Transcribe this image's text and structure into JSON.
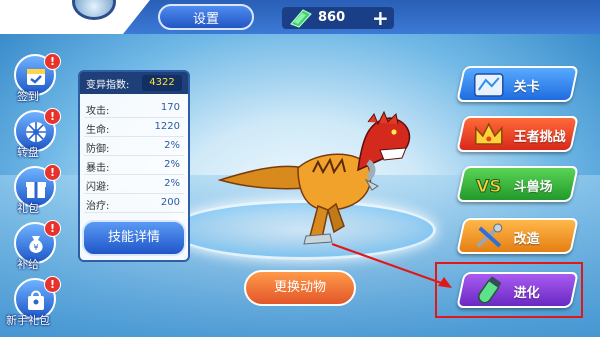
{
  "top": {
    "settings_label": "设置",
    "gem_count": "860",
    "plus_symbol": "+"
  },
  "side_buttons": [
    {
      "label": "签到",
      "badge": "!"
    },
    {
      "label": "转盘",
      "badge": "!"
    },
    {
      "label": "礼包",
      "badge": "!"
    },
    {
      "label": "补给",
      "badge": "!"
    },
    {
      "label": "新手礼包",
      "badge": "!"
    }
  ],
  "stats": {
    "mutation_label": "变异指数:",
    "mutation_value": "4322",
    "rows": [
      {
        "k": "攻击:",
        "v": "170"
      },
      {
        "k": "生命:",
        "v": "1220"
      },
      {
        "k": "防御:",
        "v": "2%"
      },
      {
        "k": "暴击:",
        "v": "2%"
      },
      {
        "k": "闪避:",
        "v": "2%"
      },
      {
        "k": "治疗:",
        "v": "200"
      }
    ],
    "skill_button": "技能详情"
  },
  "change_button": "更换动物",
  "menu": [
    {
      "label": "关卡",
      "icon": "map-icon"
    },
    {
      "label": "王者挑战",
      "icon": "crown-icon"
    },
    {
      "label": "斗兽场",
      "icon": "vs-icon"
    },
    {
      "label": "改造",
      "icon": "tools-icon"
    },
    {
      "label": "进化",
      "icon": "potion-icon"
    }
  ],
  "colors": {
    "highlight_frame": "#e01818",
    "menu_map": "#2f8ff0",
    "menu_crown": "#e8421e",
    "menu_vs": "#34b43c",
    "menu_tools": "#f29a1c",
    "menu_potion": "#8a3ad8"
  }
}
